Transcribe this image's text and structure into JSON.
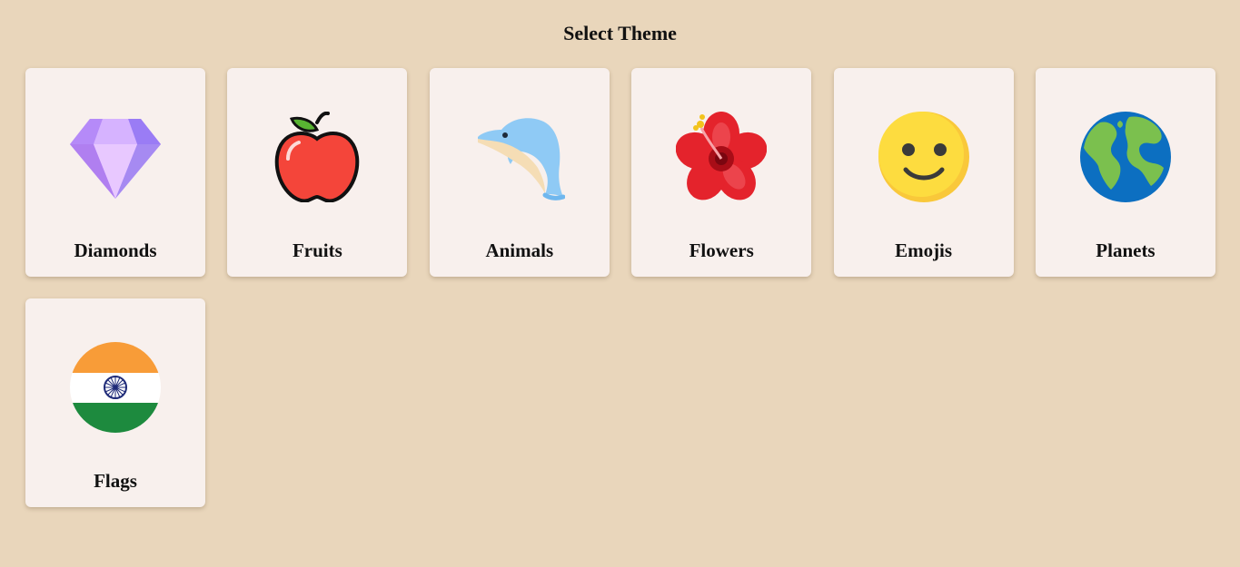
{
  "page": {
    "title": "Select Theme"
  },
  "themes": [
    {
      "label": "Diamonds",
      "icon": "diamond-icon"
    },
    {
      "label": "Fruits",
      "icon": "apple-icon"
    },
    {
      "label": "Animals",
      "icon": "dolphin-icon"
    },
    {
      "label": "Flowers",
      "icon": "hibiscus-icon"
    },
    {
      "label": "Emojis",
      "icon": "smiley-icon"
    },
    {
      "label": "Planets",
      "icon": "globe-icon"
    },
    {
      "label": "Flags",
      "icon": "india-flag-icon"
    }
  ],
  "colors": {
    "background": "#e9d6bb",
    "card": "#f8f0ed",
    "text": "#111111"
  }
}
